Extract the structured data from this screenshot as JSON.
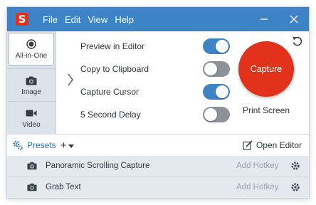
{
  "app": {
    "logo_letter": "S",
    "brand_color": "#e2321c",
    "titlebar_color": "#3d84c6"
  },
  "menu": [
    {
      "label": "File"
    },
    {
      "label": "Edit"
    },
    {
      "label": "View"
    },
    {
      "label": "Help"
    }
  ],
  "window_controls": {
    "minimize_icon": "minimize-icon",
    "close_icon": "close-icon"
  },
  "modes": [
    {
      "label": "All-in-One",
      "icon": "all-in-one-icon",
      "selected": true
    },
    {
      "label": "Image",
      "icon": "camera-icon",
      "selected": false
    },
    {
      "label": "Video",
      "icon": "video-camera-icon",
      "selected": false
    }
  ],
  "options": [
    {
      "label": "Preview in Editor",
      "on": true
    },
    {
      "label": "Copy to Clipboard",
      "on": false
    },
    {
      "label": "Capture Cursor",
      "on": true
    },
    {
      "label": "5 Second Delay",
      "on": false
    }
  ],
  "capture": {
    "button_label": "Capture",
    "hotkey": "Print Screen"
  },
  "presets_bar": {
    "presets_label": "Presets",
    "add_label": "+",
    "open_editor_label": "Open Editor"
  },
  "presets": [
    {
      "name": "Panoramic Scrolling Capture",
      "hotkey_label": "Add Hotkey"
    },
    {
      "name": "Grab Text",
      "hotkey_label": "Add Hotkey"
    }
  ]
}
